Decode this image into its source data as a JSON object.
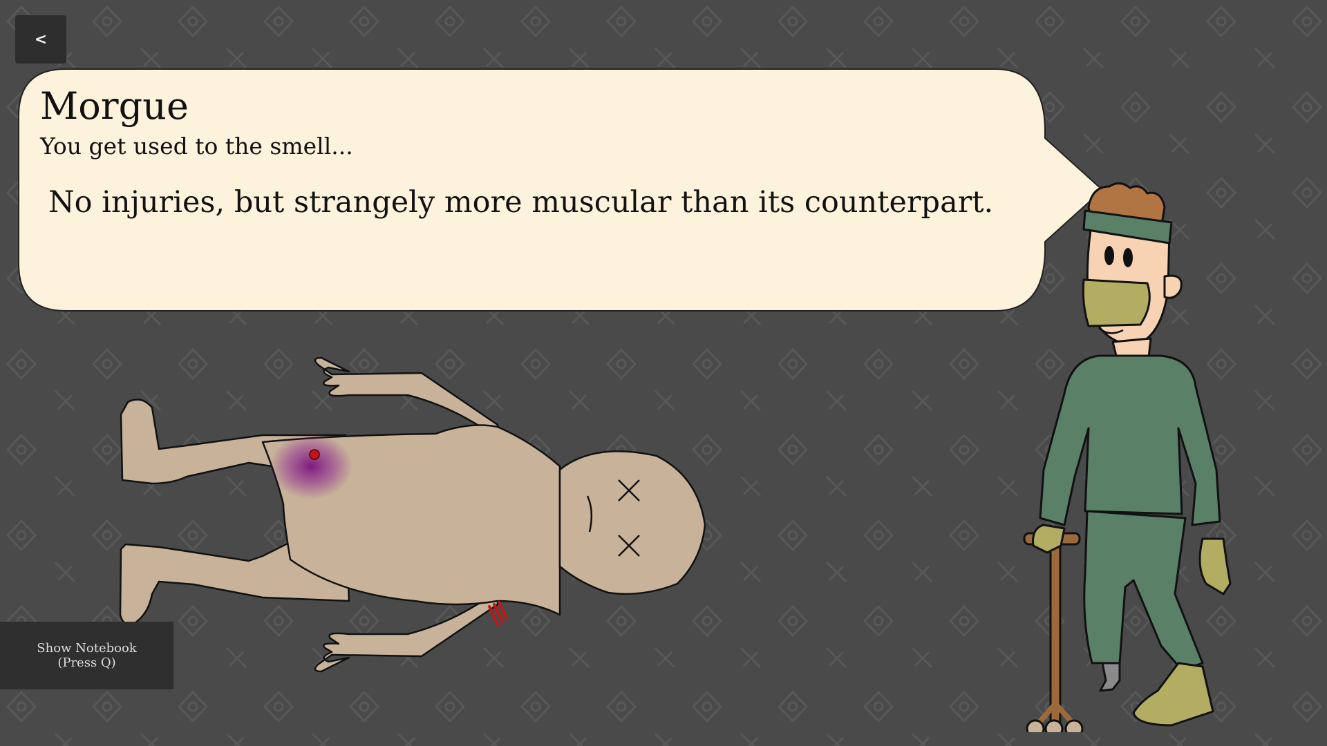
{
  "nav": {
    "back_label": "<"
  },
  "location": {
    "title": "Morgue",
    "subtitle": "You get used to the smell..."
  },
  "dialog": {
    "text": "No injuries, but strangely more muscular than its counterpart."
  },
  "notebook_button": {
    "line1": "Show Notebook",
    "line2": "(Press Q)"
  },
  "colors": {
    "background": "#4a4a4a",
    "bubble_fill": "#fdf3dc",
    "skin_corpse": "#c8b39a",
    "scrubs": "#5a8068",
    "mask": "#b2ad62",
    "bruise": "#8a1c8e",
    "wound": "#c01818"
  },
  "icons": [
    "back-arrow-icon",
    "bruise-mark",
    "wound-scratch-mark"
  ]
}
